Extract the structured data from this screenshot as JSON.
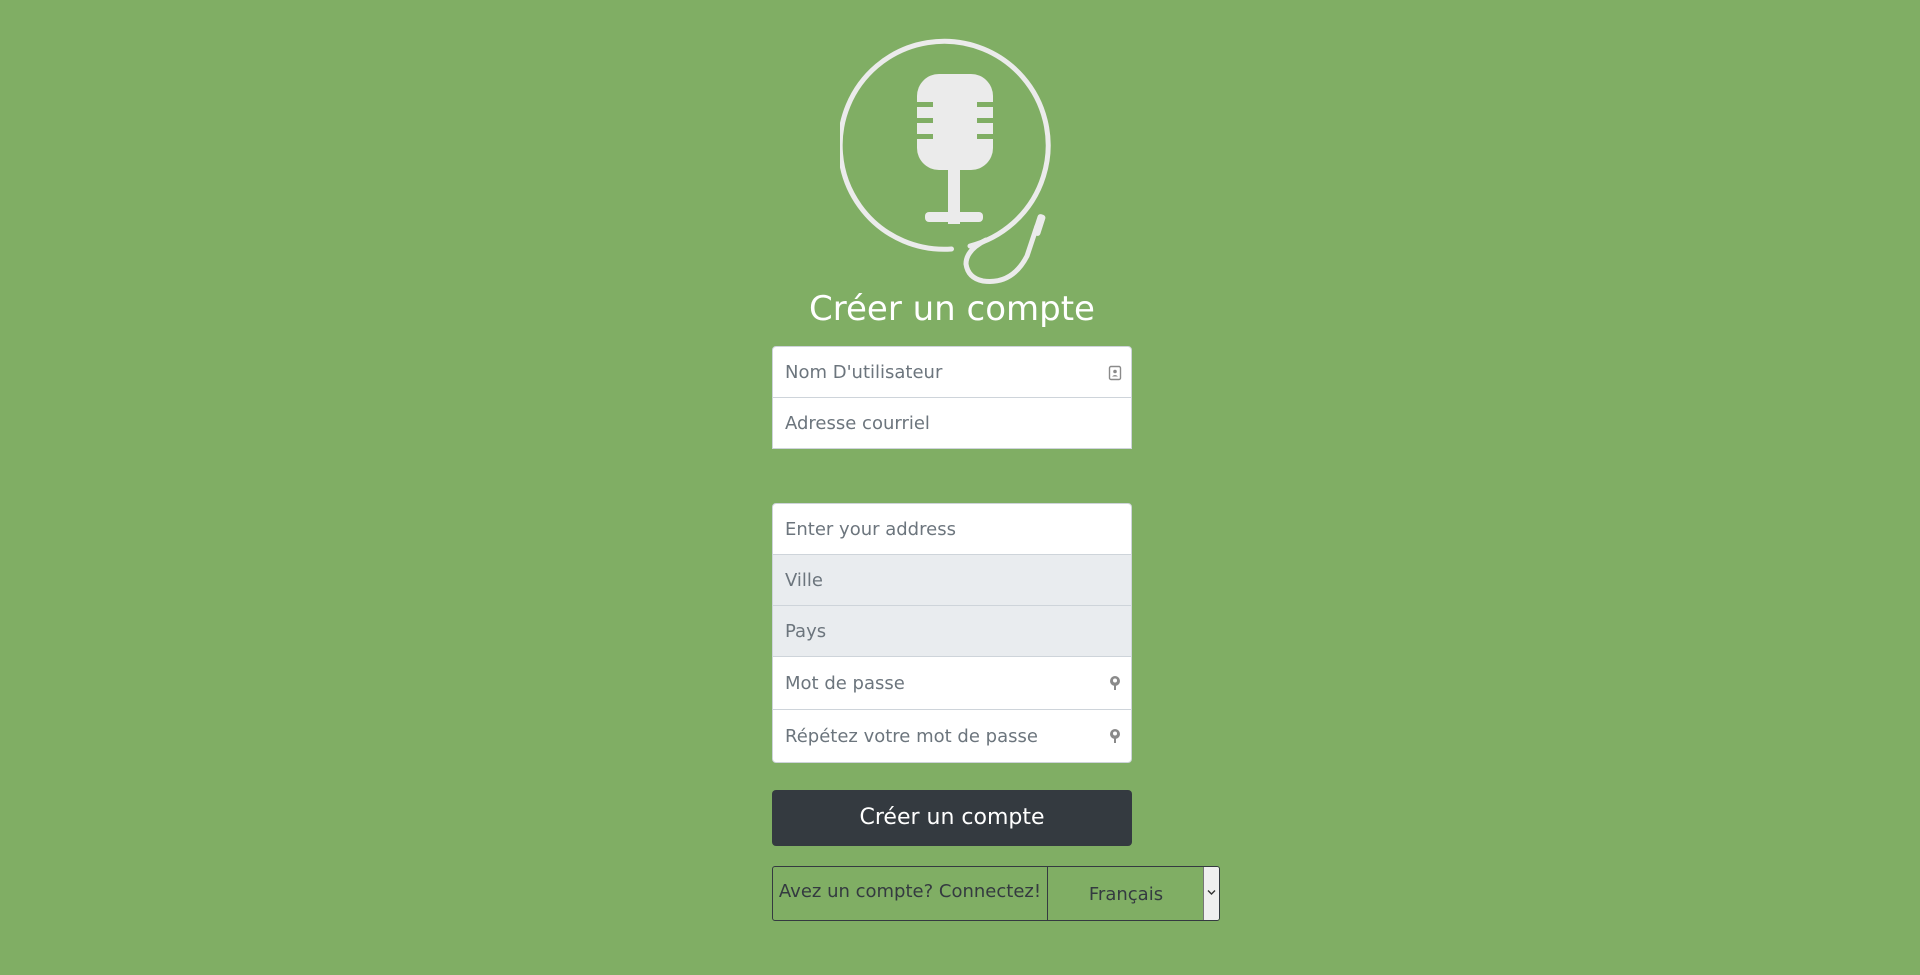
{
  "colors": {
    "background": "#80ae64",
    "button": "#343a40",
    "logo_stroke": "#ebebeb"
  },
  "logo": {
    "icon": "microphone-with-cable-logo"
  },
  "page": {
    "title": "Créer un compte"
  },
  "form": {
    "username_placeholder": "Nom D'utilisateur",
    "email_placeholder": "Adresse courriel",
    "address_placeholder": "Enter your address",
    "city_placeholder": "Ville",
    "country_placeholder": "Pays",
    "password_placeholder": "Mot de passe",
    "password_repeat_placeholder": "Répétez votre mot de passe",
    "username_icon": "contact-card-icon",
    "password_icon": "key-icon"
  },
  "actions": {
    "submit_label": "Créer un compte",
    "login_link": "Avez un compte? Connectez!"
  },
  "language": {
    "selected": "Français"
  }
}
